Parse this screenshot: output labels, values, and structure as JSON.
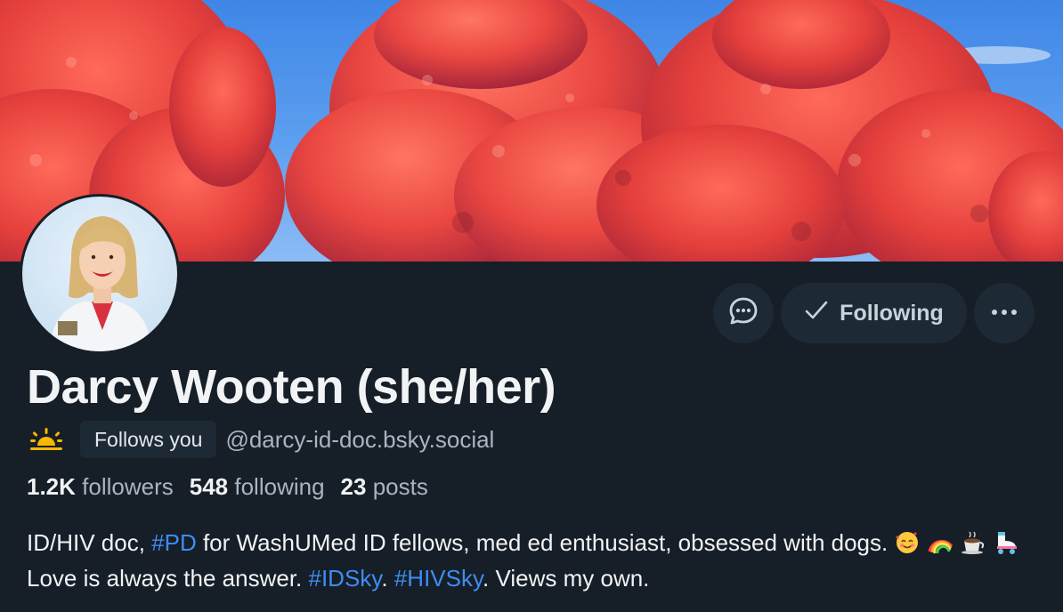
{
  "profile": {
    "display_name": "Darcy Wooten (she/her)",
    "follows_you_badge": "Follows you",
    "handle": "@darcy-id-doc.bsky.social",
    "badge_icon": "sun-over-horizon-icon"
  },
  "actions": {
    "message_icon": "chat-bubble-icon",
    "following_label": "Following",
    "following_icon": "checkmark-icon",
    "more_icon": "ellipsis-icon"
  },
  "stats": {
    "followers_count": "1.2K",
    "followers_label": "followers",
    "following_count": "548",
    "following_label": "following",
    "posts_count": "23",
    "posts_label": "posts"
  },
  "bio": {
    "part1": "ID/HIV doc, ",
    "tag1": "#PD",
    "part2": " for WashUMed ID fellows, med ed enthusiast, obsessed with dogs. ",
    "emojis": [
      "smiling-face-with-hearts",
      "rainbow",
      "hot-beverage",
      "roller-skate"
    ],
    "part3": " Love is always the answer. ",
    "tag2": "#IDSky",
    "part4": ". ",
    "tag3": "#HIVSky",
    "part5": ". Views my own."
  },
  "colors": {
    "background": "#161e27",
    "button_bg": "#1e2936",
    "accent_link": "#3f8cf2",
    "muted_text": "#aab5c0",
    "banner_foliage": "#e8413f",
    "banner_sky": "#5d9ff0"
  }
}
